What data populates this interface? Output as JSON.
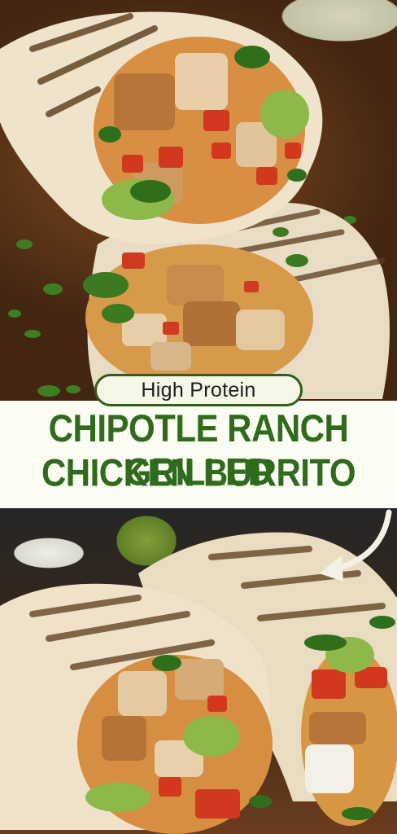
{
  "badge": {
    "label": "High Protein"
  },
  "title": {
    "line1": "CHIPOTLE RANCH GRILLED",
    "line2": "CHICKEN BURRITO"
  },
  "colors": {
    "title_green": "#2f6a1d",
    "banner_bg": "#fbfcf2",
    "badge_border": "#2e5f1f"
  },
  "icons": {
    "arrow": "curved-arrow-icon"
  }
}
